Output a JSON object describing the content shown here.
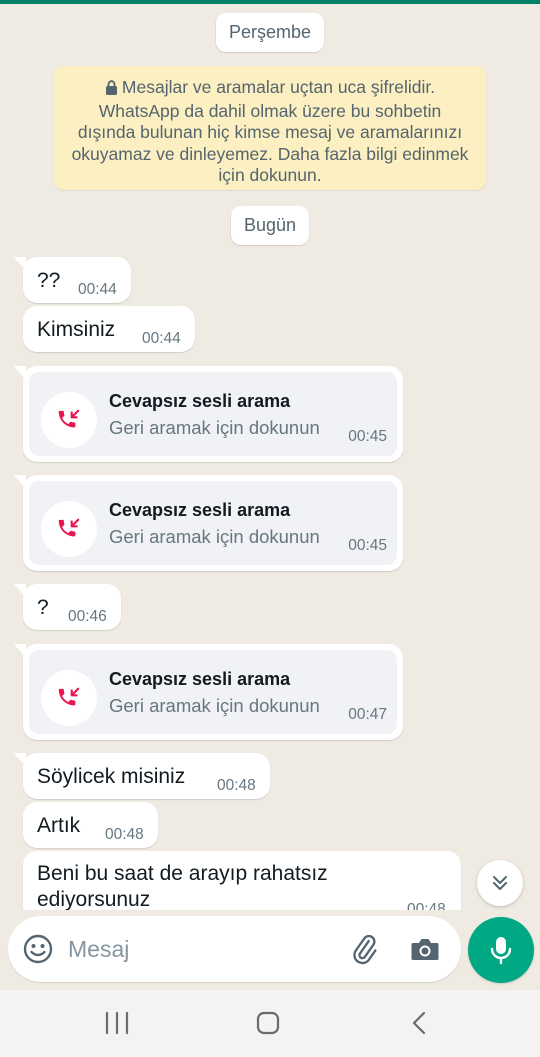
{
  "day_labels": {
    "previous": "Perşembe",
    "today": "Bugün"
  },
  "encryption_notice": "Mesajlar ve aramalar uçtan uca şifrelidir. WhatsApp da dahil olmak üzere bu sohbetin dışında bulunan hiç kimse mesaj ve aramalarınızı okuyamaz ve dinleyemez. Daha fazla bilgi edinmek için dokunun.",
  "messages": [
    {
      "type": "text",
      "text": "??",
      "time": "00:44"
    },
    {
      "type": "text",
      "text": "Kimsiniz",
      "time": "00:44"
    },
    {
      "type": "call",
      "title": "Cevapsız sesli arama",
      "subtitle": "Geri aramak için dokunun",
      "time": "00:45"
    },
    {
      "type": "call",
      "title": "Cevapsız sesli arama",
      "subtitle": "Geri aramak için dokunun",
      "time": "00:45"
    },
    {
      "type": "text",
      "text": "?",
      "time": "00:46"
    },
    {
      "type": "call",
      "title": "Cevapsız sesli arama",
      "subtitle": "Geri aramak için dokunun",
      "time": "00:47"
    },
    {
      "type": "text",
      "text": "Söylicek misiniz",
      "time": "00:48"
    },
    {
      "type": "text",
      "text": "Artık",
      "time": "00:48"
    },
    {
      "type": "text",
      "text": "Beni bu saat de arayıp rahatsız ediyorsunuz",
      "time": "00:48"
    }
  ],
  "composer": {
    "placeholder": "Mesaj"
  },
  "icons": {
    "lock": "lock-icon",
    "missed_call": "missed-call-icon",
    "scroll_down": "double-chevron-down-icon",
    "emoji": "emoji-icon",
    "attach": "paperclip-icon",
    "camera": "camera-icon",
    "mic": "microphone-icon",
    "nav_recents": "recents-icon",
    "nav_home": "home-icon",
    "nav_back": "back-icon"
  },
  "colors": {
    "accent": "#00a884",
    "header": "#008069",
    "missed_call": "#e8174f",
    "notice_bg": "#fcefc1",
    "chat_bg": "#efeae2"
  }
}
